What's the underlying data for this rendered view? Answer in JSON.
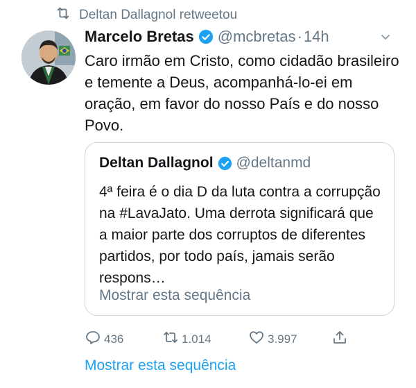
{
  "retweet": {
    "text": "Deltan Dallagnol retweetou",
    "icon": "retweet-icon"
  },
  "tweet": {
    "author_name": "Marcelo Bretas",
    "handle": "@mcbretas",
    "separator": "·",
    "time": "14h",
    "text": "Caro irmão em Cristo, como cidadão brasileiro e temente a Deus, acompanhá-lo-ei em oração, em favor do nosso País e do nosso Povo.",
    "verified_icon": "verified-badge-icon",
    "menu_icon": "chevron-down-icon"
  },
  "quote": {
    "author_name": "Deltan Dallagnol",
    "handle": "@deltanmd",
    "text": "4ª feira é o dia D da luta contra a corrupção na #LavaJato. Uma derrota significará que a maior parte dos corruptos de diferentes partidos, por todo país, jamais serão respons…",
    "show_thread": "Mostrar esta sequência"
  },
  "actions": {
    "replies": "436",
    "retweets": "1.014",
    "likes": "3.997",
    "icons": [
      "reply-icon",
      "retweet-icon",
      "like-icon",
      "share-icon"
    ]
  },
  "show_thread": "Mostrar esta sequência",
  "colors": {
    "accent": "#1da1f2",
    "muted": "#657786",
    "text": "#14171a",
    "border": "#ccd6dd"
  }
}
